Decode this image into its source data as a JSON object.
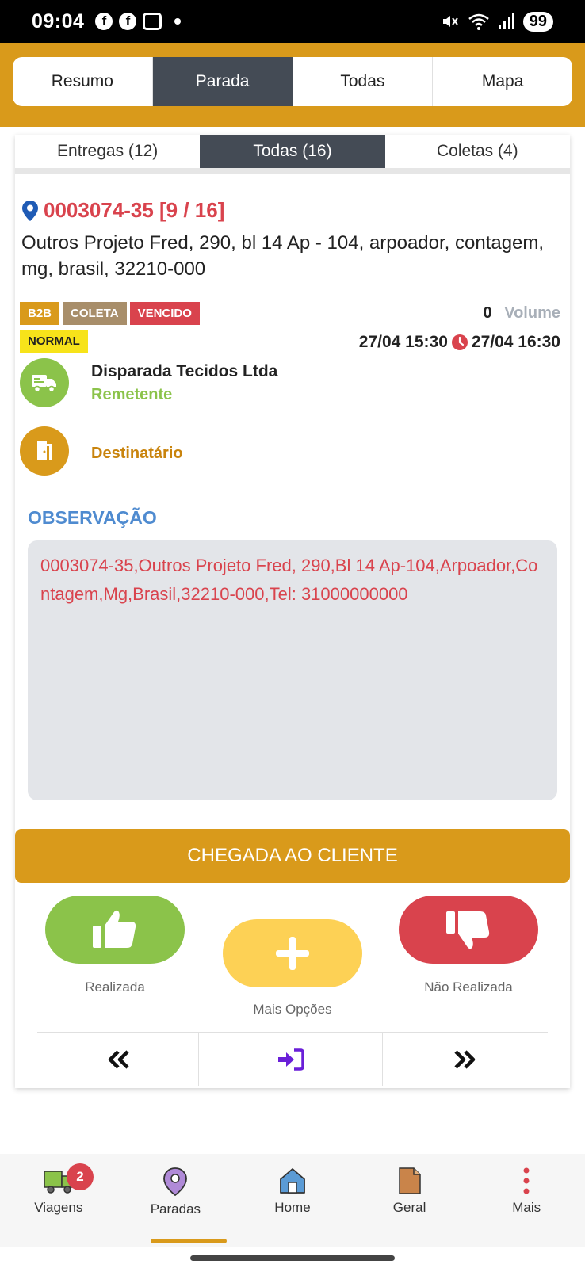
{
  "status": {
    "time": "09:04",
    "battery": "99"
  },
  "main_tabs": [
    {
      "label": "Resumo",
      "active": false
    },
    {
      "label": "Parada",
      "active": true
    },
    {
      "label": "Todas",
      "active": false
    },
    {
      "label": "Mapa",
      "active": false
    }
  ],
  "sub_tabs": [
    {
      "label": "Entregas (12)",
      "active": false
    },
    {
      "label": "Todas (16)",
      "active": true
    },
    {
      "label": "Coletas (4)",
      "active": false
    }
  ],
  "stop": {
    "code": "0003074-35 [9 / 16]",
    "address": "Outros Projeto Fred, 290, bl 14 Ap - 104, arpoador, contagem, mg, brasil, 32210-000",
    "badges": {
      "b2b": "B2B",
      "coleta": "COLETA",
      "vencido": "VENCIDO",
      "normal": "NORMAL"
    },
    "volume_count": "0",
    "volume_label": "Volume",
    "time_start": "27/04 15:30",
    "time_end": "27/04 16:30",
    "sender_name": "Disparada Tecidos Ltda",
    "sender_role": "Remetente",
    "recipient_name": "",
    "recipient_role": "Destinatário",
    "observation_title": "OBSERVAÇÃO",
    "observation_text": "0003074-35,Outros Projeto Fred, 290,Bl 14 Ap-104,Arpoador,Contagem,Mg,Brasil,32210-000,Tel: 31000000000"
  },
  "actions": {
    "arrival": "CHEGADA AO CLIENTE",
    "done": "Realizada",
    "more": "Mais Opções",
    "not_done": "Não Realizada"
  },
  "bottom_nav": {
    "trips": "Viagens",
    "trips_badge": "2",
    "stops": "Paradas",
    "home": "Home",
    "general": "Geral",
    "more": "Mais"
  },
  "colors": {
    "accent": "#d99a1b",
    "danger": "#d9434d",
    "success": "#8bc34a",
    "warning": "#fdd155",
    "tab_active": "#444b55"
  }
}
